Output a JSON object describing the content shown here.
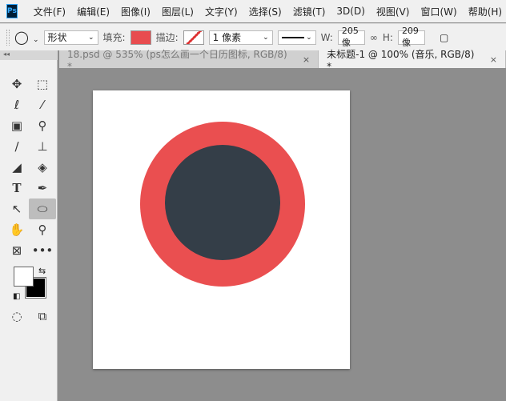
{
  "app": {
    "logo": "Ps"
  },
  "menu": [
    "文件(F)",
    "编辑(E)",
    "图像(I)",
    "图层(L)",
    "文字(Y)",
    "选择(S)",
    "滤镜(T)",
    "3D(D)",
    "视图(V)",
    "窗口(W)",
    "帮助(H)"
  ],
  "options": {
    "mode": "形状",
    "fill_label": "填充:",
    "fill_color": "#e84c4f",
    "stroke_label": "描边:",
    "stroke_size": "1 像素",
    "w_label": "W:",
    "w_value": "205 像",
    "h_label": "H:",
    "h_value": "209 像"
  },
  "tabs": [
    {
      "label": "18.psd @ 535% (ps怎么画一个日历图标, RGB/8) *",
      "close": "×"
    },
    {
      "label": "未标题-1 @ 100% (音乐, RGB/8) *",
      "close": "×"
    }
  ],
  "toolbox": {
    "collapse": "◂◂"
  },
  "canvas": {
    "outer_color": "#ea4f50",
    "inner_color": "#343e48",
    "background": "#ffffff"
  }
}
